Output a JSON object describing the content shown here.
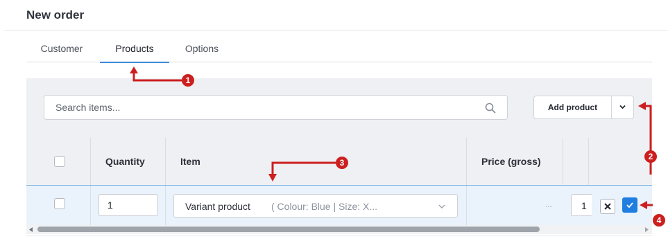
{
  "page": {
    "title": "New order"
  },
  "tabs": [
    {
      "label": "Customer",
      "active": false
    },
    {
      "label": "Products",
      "active": true
    },
    {
      "label": "Options",
      "active": false
    }
  ],
  "toolbar": {
    "search_placeholder": "Search items...",
    "add_product_label": "Add product"
  },
  "table": {
    "columns": [
      "Quantity",
      "Item",
      "Price (gross)"
    ],
    "rows": [
      {
        "quantity": "1",
        "item": "Variant product",
        "item_attributes": "( Colour: Blue | Size: X...",
        "price": "...",
        "next_value": "1"
      }
    ]
  },
  "annotations": {
    "numbers": [
      "1",
      "2",
      "3",
      "4"
    ],
    "color": "#cc1f1f"
  },
  "colors": {
    "accent": "#3d8ad6",
    "confirm_button": "#1f7ee0",
    "row_highlight": "#eaf3fb"
  }
}
